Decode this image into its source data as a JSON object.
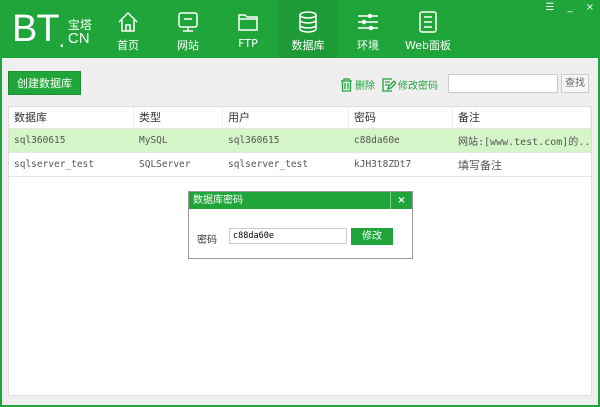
{
  "logo": {
    "main": "BT",
    "suffix": "CN",
    "zh": "宝塔"
  },
  "nav": [
    {
      "label": "首页",
      "icon": "home-icon"
    },
    {
      "label": "网站",
      "icon": "monitor-icon"
    },
    {
      "label": "FTP",
      "icon": "folder-icon"
    },
    {
      "label": "数据库",
      "icon": "database-icon",
      "active": true
    },
    {
      "label": "环境",
      "icon": "sliders-icon"
    },
    {
      "label": "Web面板",
      "icon": "list-icon"
    }
  ],
  "window": {
    "menu": "☰",
    "minimize": "_",
    "close": "×"
  },
  "toolbar": {
    "create": "创建数据库",
    "delete": "删除",
    "change_password": "修改密码",
    "search_placeholder": "",
    "search": "查找"
  },
  "table": {
    "headers": [
      "数据库",
      "类型",
      "用户",
      "密码",
      "备注"
    ],
    "rows": [
      [
        "sql360615",
        "MySQL",
        "sql360615",
        "c88da60e",
        "网站:[www.test.com]的..."
      ],
      [
        "sqlserver_test",
        "SQLServer",
        "sqlserver_test",
        "kJH3t8ZDt7",
        "填写备注"
      ]
    ]
  },
  "dialog": {
    "title": "数据库密码",
    "close": "×",
    "label": "密码",
    "value": "c88da60e",
    "submit": "修改"
  },
  "colors": {
    "brand": "#20a53a",
    "selected_row": "#d4f5c8"
  }
}
